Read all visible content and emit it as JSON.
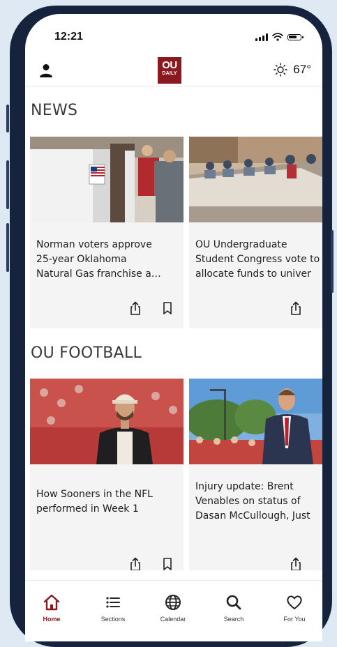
{
  "status_bar": {
    "time": "12:21"
  },
  "header": {
    "logo": {
      "line1": "OU",
      "line2": "DAILY"
    },
    "weather": {
      "temp": "67°"
    }
  },
  "sections": [
    {
      "title": "NEWS",
      "cards": [
        {
          "title": "Norman voters approve\n25-year Oklahoma\nNatural Gas franchise a…"
        },
        {
          "title": "OU Undergraduate\nStudent Congress vote to\nallocate funds to univer"
        }
      ]
    },
    {
      "title": "OU FOOTBALL",
      "cards": [
        {
          "title": "How Sooners in the NFL\nperformed in Week 1"
        },
        {
          "title": "Injury update: Brent\nVenables on status of\nDasan McCullough, Just"
        }
      ]
    }
  ],
  "bottom_nav": {
    "items": [
      {
        "label": "Home",
        "icon": "home-icon",
        "active": true
      },
      {
        "label": "Sections",
        "icon": "list-icon"
      },
      {
        "label": "Calendar",
        "icon": "globe-icon"
      },
      {
        "label": "Search",
        "icon": "search-icon"
      },
      {
        "label": "For You",
        "icon": "heart-icon"
      }
    ]
  },
  "colors": {
    "accent": "#8a1a1f",
    "frame": "#15233d",
    "background": "#dfe9f4",
    "card": "#f4f4f5"
  }
}
